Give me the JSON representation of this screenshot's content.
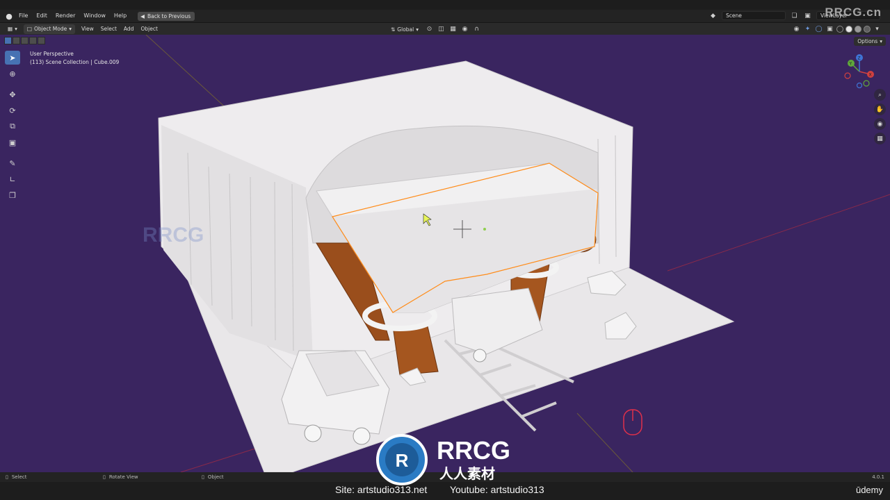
{
  "app": {
    "menu": [
      "File",
      "Edit",
      "Render",
      "Window",
      "Help"
    ],
    "back_button": "Back to Previous",
    "scene_name": "Scene",
    "view_layer": "ViewLayer"
  },
  "header": {
    "mode": "Object Mode",
    "menus": [
      "View",
      "Select",
      "Add",
      "Object"
    ],
    "orientation": "Global"
  },
  "viewport": {
    "perspective": "User Perspective",
    "collection_info": "(113) Scene Collection | Cube.009",
    "options_label": "Options",
    "gizmo_axes": [
      "X",
      "Y",
      "Z"
    ],
    "background_color": "#3a2560",
    "selection_outline_color": "#ff8c1a"
  },
  "statusbar": {
    "select": "Select",
    "rotate": "Rotate View",
    "object": "Object",
    "version": "4.0.1"
  },
  "captions": {
    "site": "Site: artstudio313.net",
    "youtube": "Youtube: artstudio313",
    "brand": "ūdemy"
  },
  "watermark": {
    "top_right": "RRCG.cn",
    "logo_text": "RRCG",
    "logo_subtext": "人人素材"
  }
}
